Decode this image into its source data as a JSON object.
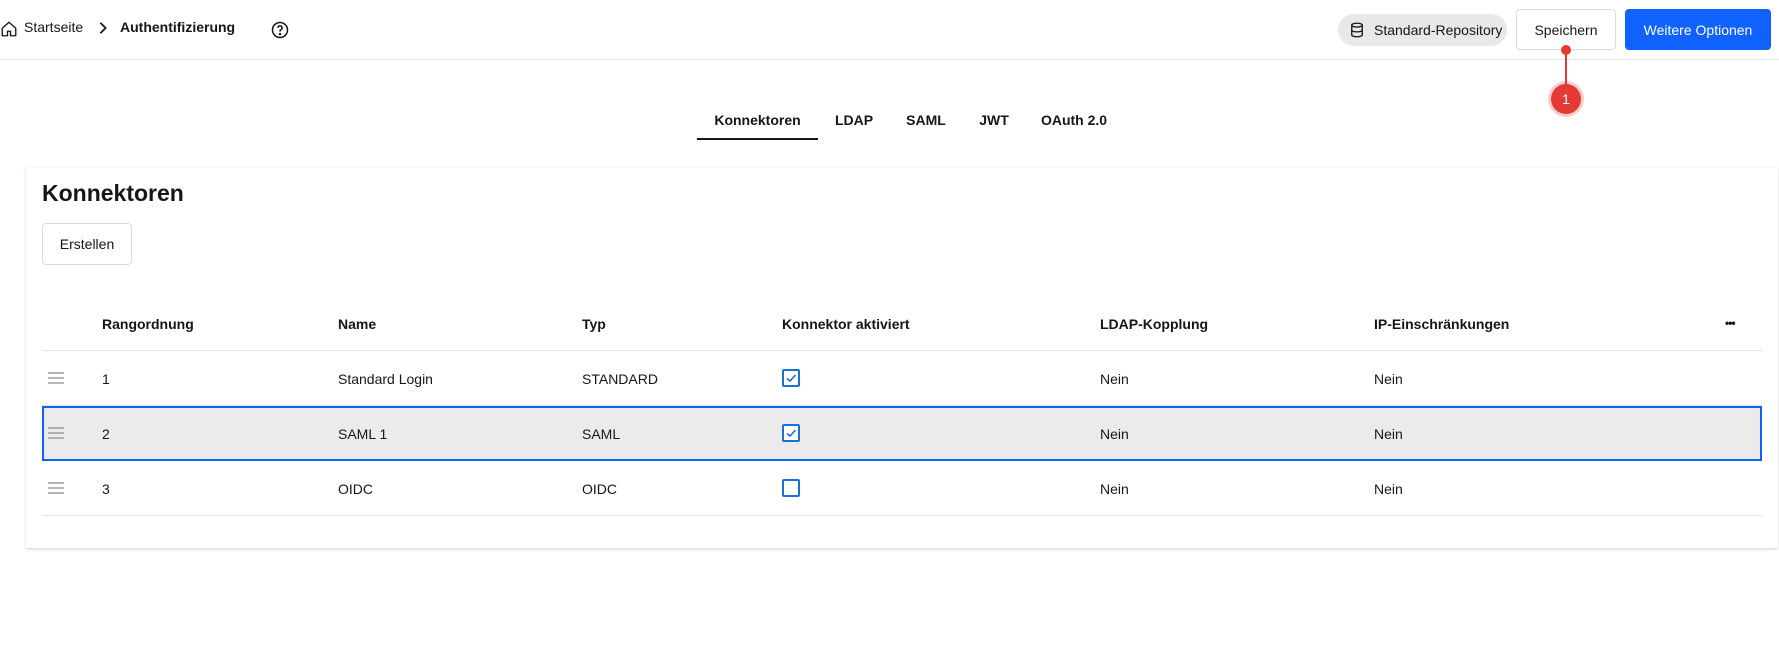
{
  "breadcrumb": {
    "home_label": "Startseite",
    "current_label": "Authentifizierung"
  },
  "header": {
    "repository_label": "Standard-Repository",
    "save_label": "Speichern",
    "more_label": "Weitere Optionen",
    "marker_number": "1"
  },
  "tabs": [
    {
      "label": "Konnektoren",
      "active": true
    },
    {
      "label": "LDAP",
      "active": false
    },
    {
      "label": "SAML",
      "active": false
    },
    {
      "label": "JWT",
      "active": false
    },
    {
      "label": "OAuth 2.0",
      "active": false
    }
  ],
  "panel": {
    "title": "Konnektoren",
    "create_label": "Erstellen"
  },
  "table": {
    "columns": {
      "rank": "Rangordnung",
      "name": "Name",
      "type": "Typ",
      "active": "Konnektor aktiviert",
      "ldap": "LDAP-Kopplung",
      "ip": "IP-Einschränkungen",
      "menu": "•••"
    },
    "rows": [
      {
        "rank": "1",
        "name": "Standard Login",
        "type": "STANDARD",
        "active": true,
        "ldap": "Nein",
        "ip": "Nein",
        "selected": false
      },
      {
        "rank": "2",
        "name": "SAML 1",
        "type": "SAML",
        "active": true,
        "ldap": "Nein",
        "ip": "Nein",
        "selected": true
      },
      {
        "rank": "3",
        "name": "OIDC",
        "type": "OIDC",
        "active": false,
        "ldap": "Nein",
        "ip": "Nein",
        "selected": false
      }
    ]
  },
  "colors": {
    "primary": "#0f62fe",
    "checkbox": "#1c6fd6",
    "marker": "#e53935"
  }
}
